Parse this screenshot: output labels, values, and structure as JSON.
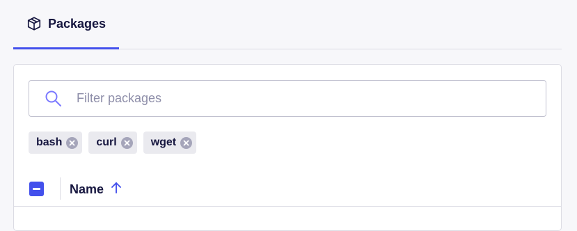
{
  "tabs": [
    {
      "label": "Packages",
      "icon": "package-icon",
      "active": true
    }
  ],
  "search": {
    "placeholder": "Filter packages",
    "value": ""
  },
  "chips": [
    {
      "label": "bash"
    },
    {
      "label": "curl"
    },
    {
      "label": "wget"
    }
  ],
  "table": {
    "select_all_state": "indeterminate",
    "columns": [
      {
        "label": "Name",
        "sort": "ascending"
      }
    ]
  },
  "colors": {
    "accent": "#4350ec",
    "text": "#16163f",
    "placeholder": "#8e8ea9",
    "chip_bg": "#eaeaef",
    "border": "#dcdce4"
  }
}
